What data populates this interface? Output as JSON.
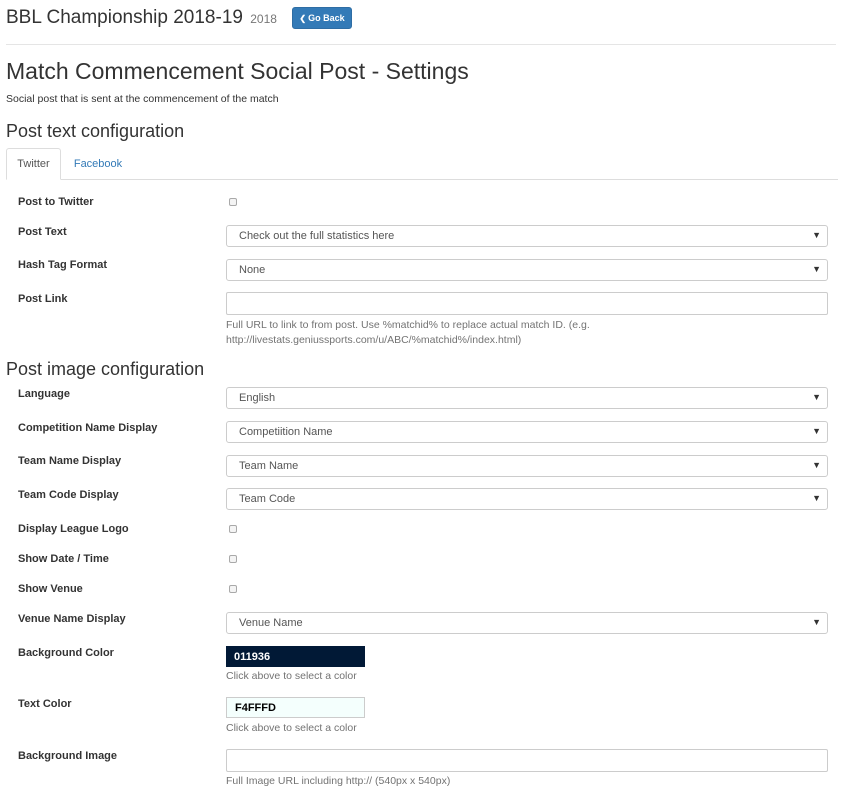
{
  "header": {
    "title": "BBL Championship 2018-19",
    "year": "2018",
    "go_back_label": "Go Back",
    "go_back_icon": "chevron-left-icon"
  },
  "page": {
    "title": "Match Commencement Social Post - Settings",
    "subtitle": "Social post that is sent at the commencement of the match"
  },
  "post_text_section": {
    "title": "Post text configuration",
    "tabs": [
      {
        "label": "Twitter",
        "active": true
      },
      {
        "label": "Facebook",
        "active": false
      }
    ],
    "fields": {
      "post_to_twitter": {
        "label": "Post to Twitter",
        "checked": false
      },
      "post_text": {
        "label": "Post Text",
        "value": "Check out the full statistics here"
      },
      "hash_tag_format": {
        "label": "Hash Tag Format",
        "value": "None"
      },
      "post_link": {
        "label": "Post Link",
        "value": "",
        "help_line1": "Full URL to link to from post. Use %matchid% to replace actual match ID. (e.g.",
        "help_line2": "http://livestats.geniussports.com/u/ABC/%matchid%/index.html)"
      }
    }
  },
  "post_image_section": {
    "title": "Post image configuration",
    "fields": {
      "language": {
        "label": "Language",
        "value": "English"
      },
      "competition_name_display": {
        "label": "Competition Name Display",
        "value": "Competiition Name"
      },
      "team_name_display": {
        "label": "Team Name Display",
        "value": "Team Name"
      },
      "team_code_display": {
        "label": "Team Code Display",
        "value": "Team Code"
      },
      "display_league_logo": {
        "label": "Display League Logo",
        "checked": false
      },
      "show_date_time": {
        "label": "Show Date / Time",
        "checked": false
      },
      "show_venue": {
        "label": "Show Venue",
        "checked": false
      },
      "venue_name_display": {
        "label": "Venue Name Display",
        "value": "Venue Name"
      },
      "background_color": {
        "label": "Background Color",
        "value": "011936",
        "swatch": "#011936",
        "text_color": "#ffffff",
        "help": "Click above to select a color"
      },
      "text_color": {
        "label": "Text Color",
        "value": "F4FFFD",
        "swatch": "#F4FFFD",
        "text_color": "#000000",
        "help": "Click above to select a color"
      },
      "background_image": {
        "label": "Background Image",
        "value": "",
        "help": "Full Image URL including http:// (540px x 540px)"
      }
    }
  },
  "icons": {
    "dropdown_caret": "triangle-down-icon"
  },
  "colors": {
    "primary": "#337ab7",
    "muted": "#737373",
    "border": "#cccccc"
  }
}
